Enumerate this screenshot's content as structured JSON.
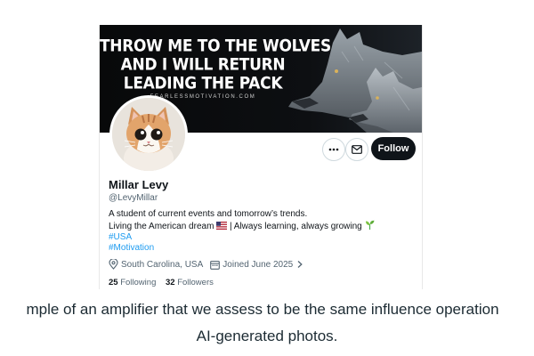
{
  "profile_card": {
    "banner": {
      "headline_lines": [
        "THROW ME TO THE WOLVES",
        "AND I WILL RETURN",
        "LEADING THE PACK"
      ],
      "site": "FEARLESSMOTIVATION.COM"
    },
    "actions": {
      "more_icon": "more-horizontal-icon",
      "message_icon": "envelope-icon",
      "follow_label": "Follow"
    },
    "name": "Millar Levy",
    "handle": "@LevyMillar",
    "bio": {
      "line1": "A student of current events and tomorrow’s trends.",
      "line2_part1": "Living the American dream",
      "line2_part2": "| Always learning, always growing",
      "hashtags": [
        "#USA",
        "#Motivation"
      ]
    },
    "location": "South Carolina, USA",
    "joined": "Joined June 2025",
    "following_count": "25",
    "following_label": "Following",
    "followers_count": "32",
    "followers_label": "Followers"
  },
  "caption": {
    "line1": "mple of an amplifier that we assess to be the same influence operation",
    "line2": "AI-generated photos."
  },
  "colors": {
    "follow_button": "#0f1419",
    "link": "#1d9bf0",
    "muted_text": "#536471",
    "caption_text": "#1c2b33"
  }
}
